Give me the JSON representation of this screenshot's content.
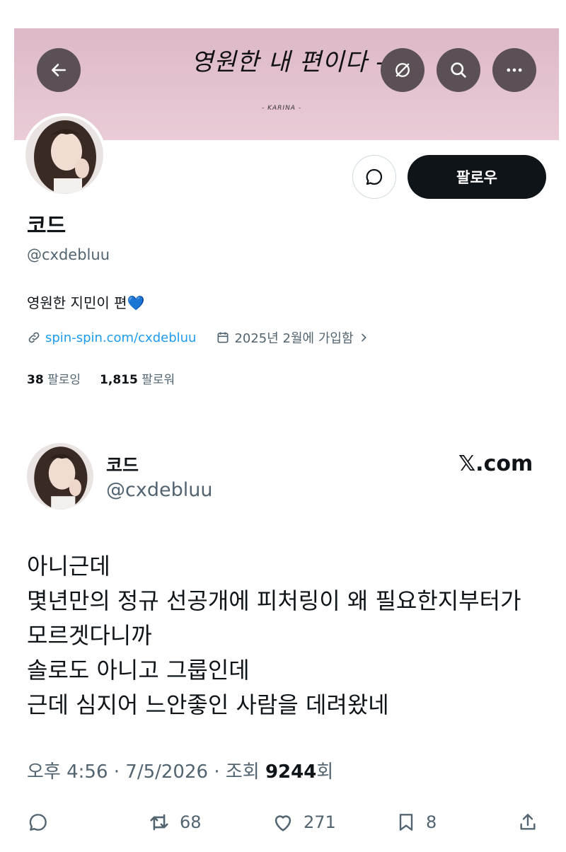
{
  "banner": {
    "script_text": "영원한 내 편이다 -",
    "subtitle": "- KARINA -"
  },
  "profile": {
    "name": "코드",
    "handle": "@cxdebluu",
    "bio": "영원한 지민이 편",
    "bio_emoji": "💙",
    "link": "spin-spin.com/cxdebluu",
    "joined": "2025년 2월에 가입함",
    "follow_label": "팔로우",
    "following_count": "38",
    "following_label": "팔로잉",
    "followers_count": "1,815",
    "followers_label": "팔로워"
  },
  "post": {
    "name": "코드",
    "handle": "@cxdebluu",
    "brand": "𝕏.com",
    "lines": [
      "아니근데",
      "몇년만의 정규 선공개에 피처링이 왜 필요한지부터가",
      "모르겟다니까",
      "솔로도 아니고 그룹인데",
      "근데 심지어 느안좋인 사람을 데려왔네"
    ],
    "time": "오후 4:56 · 7/5/2026 · 조회",
    "views": "9244",
    "views_unit": "회",
    "retweets": "68",
    "likes": "271",
    "bookmarks": "8"
  },
  "icons": [
    "back-arrow-icon",
    "grok-icon",
    "search-icon",
    "more-icon",
    "message-icon",
    "link-icon",
    "calendar-icon",
    "chevron-right-icon",
    "reply-icon",
    "retweet-icon",
    "like-icon",
    "bookmark-icon",
    "share-icon"
  ]
}
